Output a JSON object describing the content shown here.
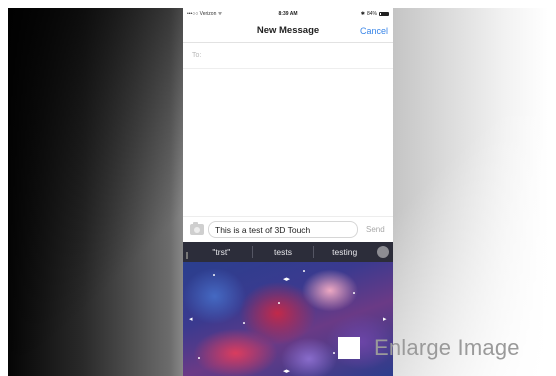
{
  "status_bar": {
    "carrier": "•••○○ Verizon",
    "time": "8:39 AM",
    "battery": "84%"
  },
  "nav": {
    "title": "New Message",
    "cancel_label": "Cancel"
  },
  "recipient": {
    "label": "To:"
  },
  "composer": {
    "message_text": "This is a test of 3D Touch",
    "send_label": "Send"
  },
  "suggestions": [
    "\"trst\"",
    "tests",
    "testing"
  ],
  "overlay": {
    "enlarge_label": "Enlarge Image"
  },
  "icons": {
    "wifi": "wifi-icon",
    "camera": "camera-icon",
    "globe": "globe-icon",
    "enlarge": "enlarge-square-icon"
  }
}
